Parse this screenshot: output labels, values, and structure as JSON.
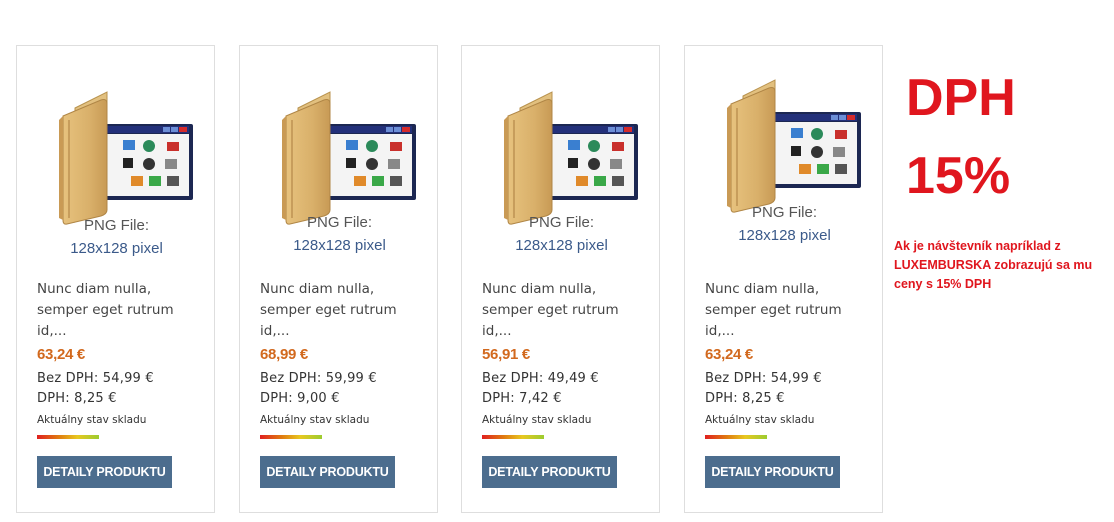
{
  "products": [
    {
      "file_type": "PNG File:",
      "file_size": "128x128 pixel",
      "description": "Nunc diam nulla, semper eget rutrum id,...",
      "price": "63,24 €",
      "bez_dph": "Bez DPH: 54,99 €",
      "dph": "DPH: 8,25 €",
      "stock_label": "Aktuálny stav skladu",
      "stock_level": 1.0,
      "button_label": "DETAILY PRODUKTU"
    },
    {
      "file_type": "PNG File:",
      "file_size": "128x128 pixel",
      "description": "Nunc diam nulla, semper eget rutrum id,...",
      "price": "68,99 €",
      "bez_dph": "Bez DPH: 59,99 €",
      "dph": "DPH: 9,00 €",
      "stock_label": "Aktuálny stav skladu",
      "stock_level": 1.0,
      "button_label": "DETAILY PRODUKTU"
    },
    {
      "file_type": "PNG File:",
      "file_size": "128x128 pixel",
      "description": "Nunc diam nulla, semper eget rutrum id,...",
      "price": "56,91 €",
      "bez_dph": "Bez DPH: 49,49 €",
      "dph": "DPH: 7,42 €",
      "stock_label": "Aktuálny stav skladu",
      "stock_level": 1.0,
      "button_label": "DETAILY PRODUKTU"
    },
    {
      "file_type": "PNG File:",
      "file_size": "128x128 pixel",
      "description": "Nunc diam nulla, semper eget rutrum id,...",
      "price": "63,24 €",
      "bez_dph": "Bez DPH: 54,99 €",
      "dph": "DPH: 8,25 €",
      "stock_label": "Aktuálny stav skladu",
      "stock_level": 1.0,
      "button_label": "DETAILY PRODUKTU"
    }
  ],
  "thumbnail_icon": "folder-with-window-icon",
  "tax_banner": {
    "title": "DPH",
    "rate": "15%",
    "note": "Ak je návštevník napríklad z LUXEMBURSKA zobrazujú sa mu ceny s 15% DPH"
  },
  "colors": {
    "price": "#d2691e",
    "button": "#4c6d8e",
    "banner": "#e0161e",
    "link": "#3b5a8a"
  }
}
